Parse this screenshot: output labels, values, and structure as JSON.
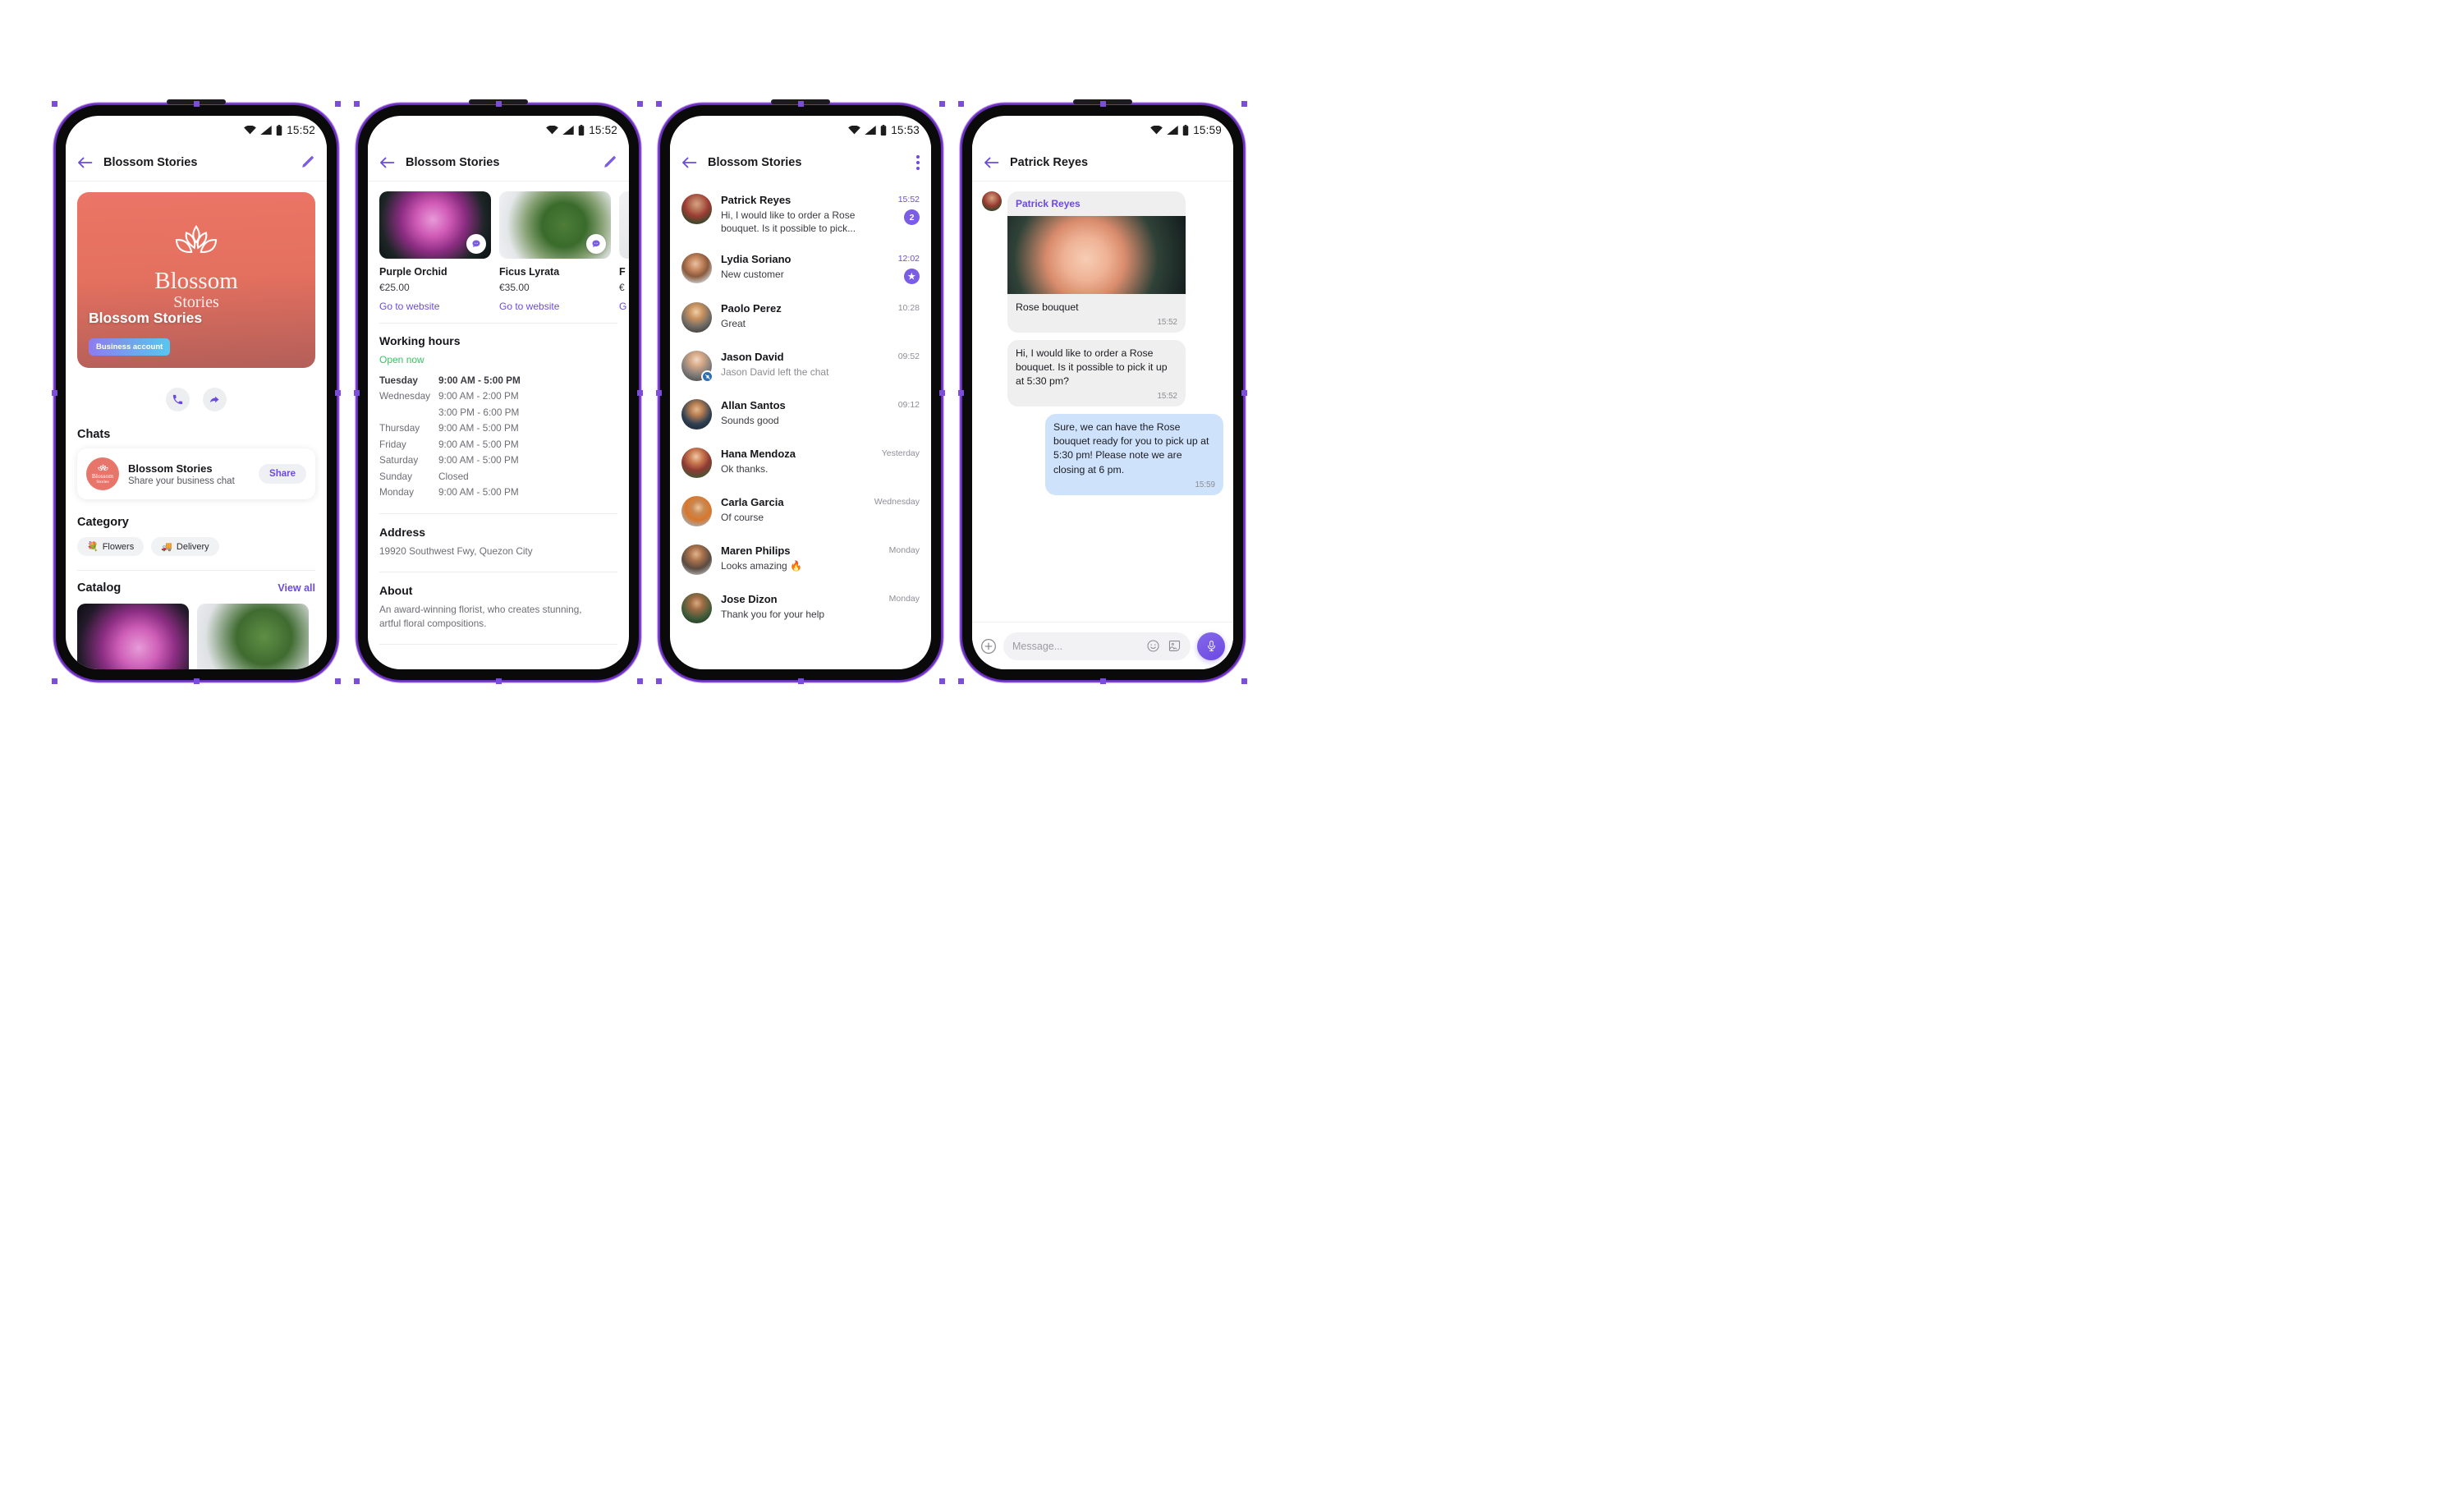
{
  "colors": {
    "accent_purple": "#6c4ae0",
    "brand_coral": "#e8756a",
    "open_green": "#38c463",
    "outgoing_bubble": "#cfe2fb",
    "incoming_bubble": "#efefef",
    "frame_outline": "#6a2fbd"
  },
  "phone1": {
    "status": {
      "time": "15:52"
    },
    "appbar": {
      "title": "Blossom Stories",
      "back_icon": "back-arrow-icon",
      "edit_icon": "pencil-icon"
    },
    "hero": {
      "logo_line1": "Blossom",
      "logo_line2": "Stories",
      "business_name": "Blossom Stories",
      "badge": "Business account"
    },
    "actions": [
      {
        "name": "call-button",
        "icon": "phone-icon"
      },
      {
        "name": "share-button",
        "icon": "forward-arrow-icon"
      }
    ],
    "chats": {
      "heading": "Chats",
      "card": {
        "avatar_line1": "Blossom",
        "avatar_line2": "Stories",
        "title": "Blossom Stories",
        "subtitle": "Share your business chat",
        "button": "Share"
      }
    },
    "category": {
      "heading": "Category",
      "chips": [
        {
          "emoji": "💐",
          "label": "Flowers"
        },
        {
          "emoji": "🚚",
          "label": "Delivery"
        }
      ]
    },
    "catalog": {
      "heading": "Catalog",
      "view_all": "View all"
    }
  },
  "phone2": {
    "status": {
      "time": "15:52"
    },
    "appbar": {
      "title": "Blossom Stories",
      "back_icon": "back-arrow-icon",
      "edit_icon": "pencil-icon"
    },
    "products": [
      {
        "name": "Purple Orchid",
        "price": "€25.00",
        "link": "Go to website",
        "chat_icon": "chat-bubble-icon"
      },
      {
        "name": "Ficus Lyrata",
        "price": "€35.00",
        "link": "Go to website",
        "chat_icon": "chat-bubble-icon"
      },
      {
        "name": "F",
        "price": "€",
        "link": "G",
        "chat_icon": "chat-bubble-icon"
      }
    ],
    "working_hours": {
      "heading": "Working hours",
      "status": "Open now",
      "rows": [
        {
          "day": "Tuesday",
          "hours": "9:00 AM - 5:00 PM",
          "today": true
        },
        {
          "day": "Wednesday",
          "hours": "9:00 AM - 2:00 PM",
          "today": false
        },
        {
          "day": "",
          "hours": "3:00 PM - 6:00 PM",
          "today": false
        },
        {
          "day": "Thursday",
          "hours": "9:00 AM - 5:00 PM",
          "today": false
        },
        {
          "day": "Friday",
          "hours": "9:00 AM - 5:00 PM",
          "today": false
        },
        {
          "day": "Saturday",
          "hours": "9:00 AM - 5:00 PM",
          "today": false
        },
        {
          "day": "Sunday",
          "hours": "Closed",
          "today": false
        },
        {
          "day": "Monday",
          "hours": "9:00 AM - 5:00 PM",
          "today": false
        }
      ]
    },
    "address": {
      "heading": "Address",
      "value": "19920 Southwest Fwy, Quezon City"
    },
    "about": {
      "heading": "About",
      "value": "An award-winning florist, who creates stunning, artful floral compositions."
    }
  },
  "phone3": {
    "status": {
      "time": "15:53"
    },
    "appbar": {
      "title": "Blossom Stories",
      "back_icon": "back-arrow-icon",
      "menu_icon": "kebab-menu-icon"
    },
    "rows": [
      {
        "name": "Patrick Reyes",
        "message": "Hi, I would like to order a Rose bouquet. Is it possible to pick...",
        "time": "15:52",
        "time_purple": true,
        "badge": "2",
        "muted": false,
        "left_badge": false
      },
      {
        "name": "Lydia Soriano",
        "message": "New customer",
        "time": "12:02",
        "time_purple": true,
        "badge": "★",
        "muted": false,
        "left_badge": false
      },
      {
        "name": "Paolo Perez",
        "message": "Great",
        "time": "10:28",
        "time_purple": false,
        "badge": "",
        "muted": false,
        "left_badge": false
      },
      {
        "name": "Jason David",
        "message": "Jason David left the chat",
        "time": "09:52",
        "time_purple": false,
        "badge": "",
        "muted": true,
        "left_badge": true
      },
      {
        "name": "Allan Santos",
        "message": "Sounds good",
        "time": "09:12",
        "time_purple": false,
        "badge": "",
        "muted": false,
        "left_badge": false
      },
      {
        "name": "Hana Mendoza",
        "message": "Ok thanks.",
        "time": "Yesterday",
        "time_purple": false,
        "badge": "",
        "muted": false,
        "left_badge": false
      },
      {
        "name": "Carla Garcia",
        "message": "Of course",
        "time": "Wednesday",
        "time_purple": false,
        "badge": "",
        "muted": false,
        "left_badge": false
      },
      {
        "name": "Maren Philips",
        "message": "Looks amazing 🔥",
        "time": "Monday",
        "time_purple": false,
        "badge": "",
        "muted": false,
        "left_badge": false
      },
      {
        "name": "Jose Dizon",
        "message": "Thank you for your help",
        "time": "Monday",
        "time_purple": false,
        "badge": "",
        "muted": false,
        "left_badge": false
      }
    ]
  },
  "phone4": {
    "status": {
      "time": "15:59"
    },
    "appbar": {
      "title": "Patrick Reyes",
      "back_icon": "back-arrow-icon"
    },
    "messages": [
      {
        "type": "card",
        "sender": "Patrick Reyes",
        "caption": "Rose bouquet",
        "time": "15:52",
        "side": "in"
      },
      {
        "type": "text",
        "text": "Hi, I would like to order a Rose bouquet. Is it possible to pick it up at 5:30 pm?",
        "time": "15:52",
        "side": "in"
      },
      {
        "type": "text",
        "text": "Sure, we can have the Rose bouquet ready for you to pick up at 5:30 pm! Please note we are closing at 6 pm.",
        "time": "15:59",
        "side": "out"
      }
    ],
    "composer": {
      "plus_icon": "plus-circle-icon",
      "placeholder": "Message...",
      "emoji_icon": "smiley-icon",
      "sticker_icon": "sticker-image-icon",
      "mic_icon": "microphone-icon"
    }
  }
}
